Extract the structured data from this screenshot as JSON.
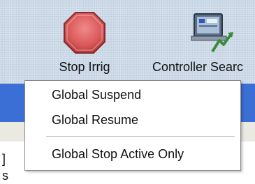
{
  "toolbar": {
    "stop_irrig_label": "Stop Irrig",
    "controller_search_label": "Controller Searc",
    "stop_icon_color": "#d95757",
    "controller_icon_color": "#4b6a8d"
  },
  "menu": {
    "items": [
      {
        "label": "Global Suspend"
      },
      {
        "label": "Global Resume"
      },
      {
        "label": "Global Stop Active Only"
      }
    ]
  },
  "background_fragments": {
    "char1": "]",
    "char2": "s"
  },
  "colors": {
    "toolbar_bg": "#c9d7e6",
    "selection_band": "#3b6fd6",
    "menu_bg": "#ffffff",
    "menu_border": "#8a8a8a"
  }
}
